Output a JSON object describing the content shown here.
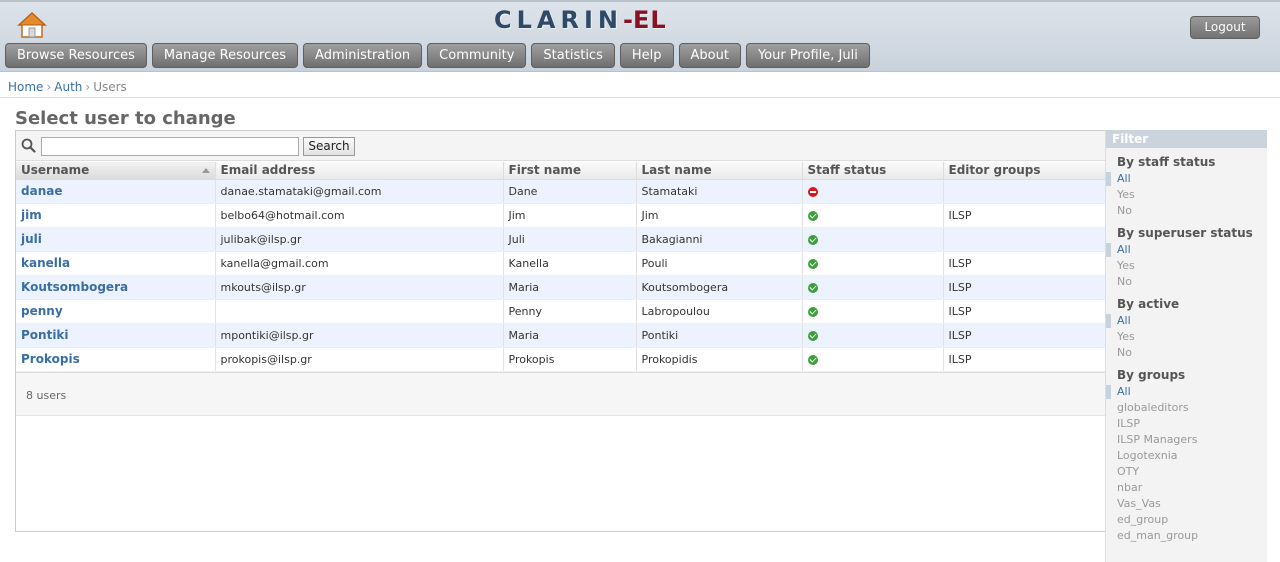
{
  "header": {
    "logo_main": "CLARIN",
    "logo_dash": "-",
    "logo_suffix": "EL",
    "logout_label": "Logout",
    "nav": [
      {
        "label": "Browse Resources"
      },
      {
        "label": "Manage Resources"
      },
      {
        "label": "Administration"
      },
      {
        "label": "Community"
      },
      {
        "label": "Statistics"
      },
      {
        "label": "Help"
      },
      {
        "label": "About"
      },
      {
        "label": "Your Profile, Juli"
      }
    ]
  },
  "breadcrumbs": [
    "Home",
    "Auth",
    "Users"
  ],
  "page": {
    "title": "Select user to change"
  },
  "search": {
    "value": "",
    "button_label": "Search"
  },
  "table": {
    "columns": [
      "Username",
      "Email address",
      "First name",
      "Last name",
      "Staff status",
      "Editor groups"
    ],
    "sorted_column": "Username",
    "rows": [
      {
        "username": "danae",
        "email": "danae.stamataki@gmail.com",
        "first_name": "Dane",
        "last_name": "Stamataki",
        "staff": false,
        "groups": ""
      },
      {
        "username": "jim",
        "email": "belbo64@hotmail.com",
        "first_name": "Jim",
        "last_name": "Jim",
        "staff": true,
        "groups": "ILSP"
      },
      {
        "username": "juli",
        "email": "julibak@ilsp.gr",
        "first_name": "Juli",
        "last_name": "Bakagianni",
        "staff": true,
        "groups": ""
      },
      {
        "username": "kanella",
        "email": "kanella@gmail.com",
        "first_name": "Kanella",
        "last_name": "Pouli",
        "staff": true,
        "groups": "ILSP"
      },
      {
        "username": "Koutsombogera",
        "email": "mkouts@ilsp.gr",
        "first_name": "Maria",
        "last_name": "Koutsombogera",
        "staff": true,
        "groups": "ILSP"
      },
      {
        "username": "penny",
        "email": "",
        "first_name": "Penny",
        "last_name": "Labropoulou",
        "staff": true,
        "groups": "ILSP"
      },
      {
        "username": "Pontiki",
        "email": "mpontiki@ilsp.gr",
        "first_name": "Maria",
        "last_name": "Pontiki",
        "staff": true,
        "groups": "ILSP"
      },
      {
        "username": "Prokopis",
        "email": "prokopis@ilsp.gr",
        "first_name": "Prokopis",
        "last_name": "Prokopidis",
        "staff": true,
        "groups": "ILSP"
      }
    ],
    "result_count": "8 users"
  },
  "filter": {
    "title": "Filter",
    "sections": [
      {
        "heading": "By staff status",
        "options": [
          "All",
          "Yes",
          "No"
        ],
        "selected": "All"
      },
      {
        "heading": "By superuser status",
        "options": [
          "All",
          "Yes",
          "No"
        ],
        "selected": "All"
      },
      {
        "heading": "By active",
        "options": [
          "All",
          "Yes",
          "No"
        ],
        "selected": "All"
      },
      {
        "heading": "By groups",
        "options": [
          "All",
          "globaleditors",
          "ILSP",
          "ILSP Managers",
          "Logotexnia",
          "OTY",
          "nbar",
          "Vas_Vas",
          "ed_group",
          "ed_man_group"
        ],
        "selected": "All"
      }
    ]
  },
  "colors": {
    "header_bg": "#c9d2dc",
    "logo_blue": "#2f4a67",
    "logo_red": "#8a1022",
    "link": "#3b6ea5",
    "row_alt": "#edf3fe",
    "staff_yes": "#3aa03a",
    "staff_no": "#d41a1a"
  }
}
